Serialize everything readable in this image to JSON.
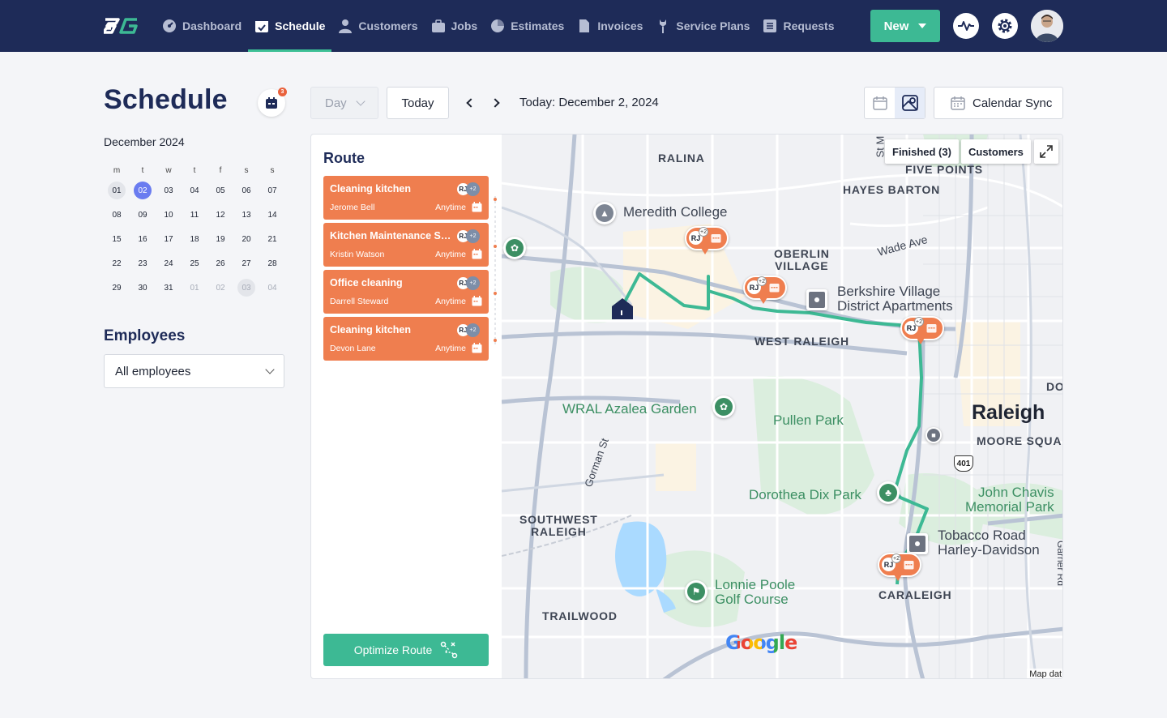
{
  "nav": {
    "items": [
      {
        "label": "Dashboard",
        "icon": "dashboard-icon"
      },
      {
        "label": "Schedule",
        "icon": "calendar-check-icon",
        "active": true
      },
      {
        "label": "Customers",
        "icon": "user-icon"
      },
      {
        "label": "Jobs",
        "icon": "briefcase-icon"
      },
      {
        "label": "Estimates",
        "icon": "pie-icon"
      },
      {
        "label": "Invoices",
        "icon": "document-icon"
      },
      {
        "label": "Service Plans",
        "icon": "wrench-icon"
      },
      {
        "label": "Requests",
        "icon": "list-icon"
      }
    ],
    "new_label": "New"
  },
  "page": {
    "title": "Schedule",
    "badge_count": "3"
  },
  "mini_calendar": {
    "month": "December 2024",
    "weekdays": [
      "m",
      "t",
      "w",
      "t",
      "f",
      "s",
      "s"
    ],
    "weeks": [
      [
        "01",
        "02",
        "03",
        "04",
        "05",
        "06",
        "07"
      ],
      [
        "08",
        "09",
        "10",
        "11",
        "12",
        "13",
        "14"
      ],
      [
        "15",
        "16",
        "17",
        "18",
        "19",
        "20",
        "21"
      ],
      [
        "22",
        "23",
        "24",
        "25",
        "26",
        "27",
        "28"
      ],
      [
        "29",
        "30",
        "31",
        "01",
        "02",
        "03",
        "04"
      ]
    ]
  },
  "employees": {
    "title": "Employees",
    "selected": "All employees"
  },
  "toolbar": {
    "view_select": "Day",
    "today_label": "Today",
    "date_label": "Today: December 2, 2024",
    "calendar_sync_label": "Calendar Sync"
  },
  "route": {
    "title": "Route",
    "jobs": [
      {
        "title": "Cleaning kitchen",
        "client": "Jerome Bell",
        "time": "Anytime",
        "initials": "RJ",
        "extra": "+2"
      },
      {
        "title": "Kitchen Maintenance Service",
        "client": "Kristin Watson",
        "time": "Anytime",
        "initials": "RJ",
        "extra": "+2"
      },
      {
        "title": "Office cleaning",
        "client": "Darrell Steward",
        "time": "Anytime",
        "initials": "RJ",
        "extra": "+2"
      },
      {
        "title": "Cleaning kitchen",
        "client": "Devon Lane",
        "time": "Anytime",
        "initials": "RJ",
        "extra": "+2"
      }
    ],
    "optimize_label": "Optimize Route"
  },
  "map": {
    "finished_label": "Finished (3)",
    "customers_label": "Customers",
    "areas": {
      "ralina": "RALINA",
      "five_points": "FIVE POINTS",
      "hayes_barton": "HAYES BARTON",
      "oberlin": "OBERLIN\nVILLAGE",
      "west_raleigh": "WEST RALEIGH",
      "sw_raleigh": "SOUTHWEST\nRALEIGH",
      "trailwood": "TRAILWOOD",
      "caraleigh": "CARALEIGH",
      "moore_square": "MOORE SQUA",
      "do": "DO"
    },
    "pois": {
      "meredith": "Meredith College",
      "berkshire": "Berkshire Village\nDistrict Apartments",
      "wral": "WRAL Azalea Garden",
      "pullen": "Pullen Park",
      "raleigh": "Raleigh",
      "dorothea": "Dorothea Dix Park",
      "john_chavis": "John Chavis\nMemorial Park",
      "tobacco": "Tobacco Road\nHarley-Davidson",
      "lonnie": "Lonnie Poole\nGolf Course"
    },
    "streets": {
      "wade": "Wade Ave",
      "gorman": "Gorman St",
      "st_m": "St M",
      "hwy401": "401",
      "gamer": "Garner Rd"
    },
    "pin": {
      "initials": "RJ",
      "extra": "+2"
    },
    "google": "Google",
    "map_data": "Map dat"
  },
  "colors": {
    "nav_bg": "#1e2b58",
    "accent": "#3db994",
    "job_orange": "#ef7e4f",
    "route_line": "#3db994"
  }
}
